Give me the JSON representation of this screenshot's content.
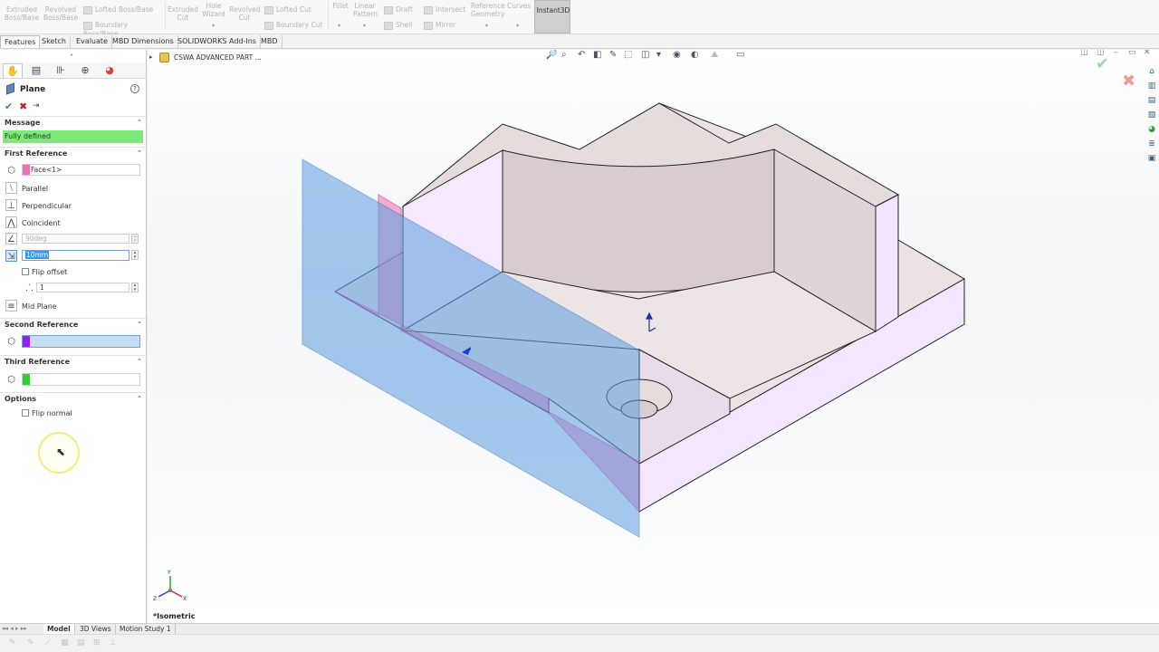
{
  "ribbon": {
    "extruded_boss": "Extruded Boss/Base",
    "revolved_boss": "Revolved Boss/Base",
    "lofted_boss": "Lofted Boss/Base",
    "boundary_boss": "Boundary Boss/Base",
    "extruded_cut": "Extruded Cut",
    "hole_wizard": "Hole Wizard",
    "revolved_cut": "Revolved Cut",
    "lofted_cut": "Lofted Cut",
    "boundary_cut": "Boundary Cut",
    "fillet": "Fillet",
    "linear_pattern": "Linear Pattern",
    "draft": "Draft",
    "intersect": "Intersect",
    "shell": "Shell",
    "mirror": "Mirror",
    "reference_geometry": "Reference Geometry",
    "curves": "Curves",
    "instant3d": "Instant3D"
  },
  "tabs": [
    "Features",
    "Sketch",
    "Evaluate",
    "MBD Dimensions",
    "SOLIDWORKS Add-Ins",
    "MBD"
  ],
  "active_tab": "Features",
  "property_manager": {
    "title": "Plane",
    "message_section": "Message",
    "message_text": "Fully defined",
    "message_color": "#7ee87a",
    "first_reference": {
      "title": "First Reference",
      "selection": "Face<1>",
      "selection_color": "#f06fb4",
      "parallel": "Parallel",
      "perpendicular": "Perpendicular",
      "coincident": "Coincident",
      "angle_value": "90deg",
      "distance_value": "10mm",
      "flip_offset": "Flip offset",
      "instances": "1",
      "mid_plane": "Mid Plane"
    },
    "second_reference": {
      "title": "Second Reference",
      "color": "#9b1df0"
    },
    "third_reference": {
      "title": "Third Reference",
      "color": "#2fd02f"
    },
    "options": {
      "title": "Options",
      "flip_normal": "Flip normal"
    }
  },
  "feature_tree": {
    "part_name": "CSWA ADVANCED PART ..."
  },
  "viewport": {
    "view_name": "*Isometric"
  },
  "bottom_tabs": [
    "Model",
    "3D Views",
    "Motion Study 1"
  ],
  "active_bottom_tab": "Model"
}
